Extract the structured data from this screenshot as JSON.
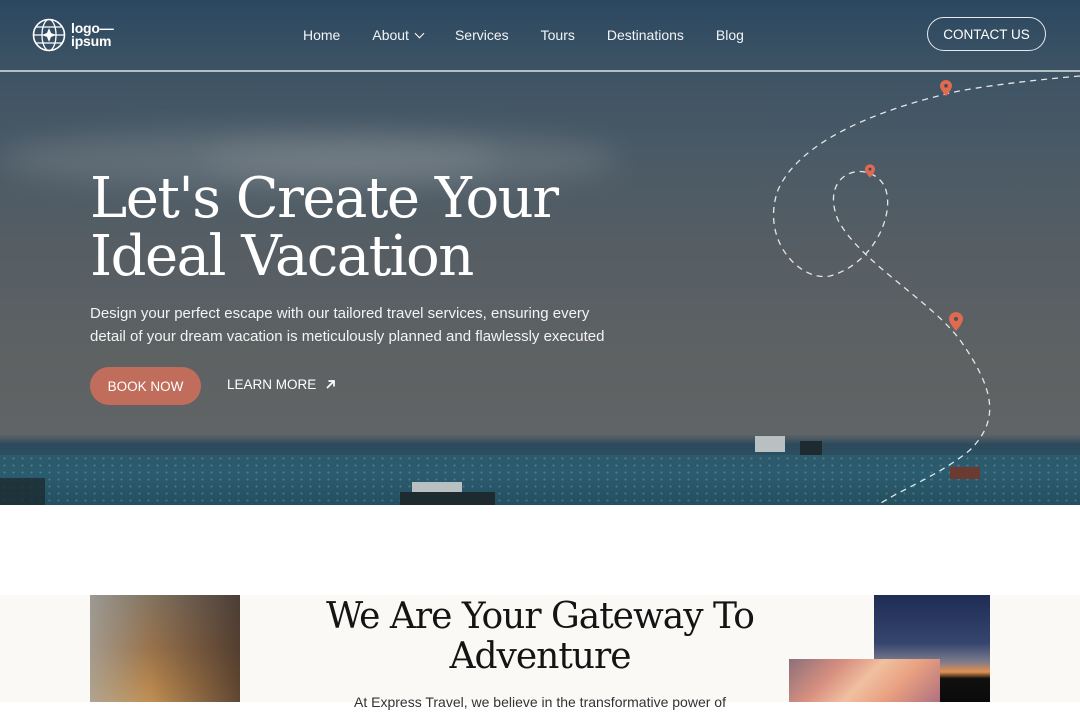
{
  "header": {
    "logo_line1": "logo—",
    "logo_line2": "ipsum",
    "nav": [
      {
        "label": "Home"
      },
      {
        "label": "About",
        "has_dropdown": true
      },
      {
        "label": "Services"
      },
      {
        "label": "Tours"
      },
      {
        "label": "Destinations"
      },
      {
        "label": "Blog"
      }
    ],
    "contact_label": "CONTACT US"
  },
  "hero": {
    "title_line1": "Let's Create Your",
    "title_line2": "Ideal Vacation",
    "subtitle_line1": "Design your perfect escape with our tailored travel services, ensuring every",
    "subtitle_line2": "detail of your dream vacation is meticulously planned and flawlessly executed",
    "primary_cta": "BOOK NOW",
    "secondary_cta": "LEARN MORE",
    "secondary_icon": "arrow-up-right-icon",
    "accent_color": "#c06d5c",
    "pin_color": "#e06a50"
  },
  "about": {
    "title_line1": "We Are Your Gateway To",
    "title_line2": "Adventure",
    "intro_text": "At Express Travel, we believe in the transformative power of"
  }
}
